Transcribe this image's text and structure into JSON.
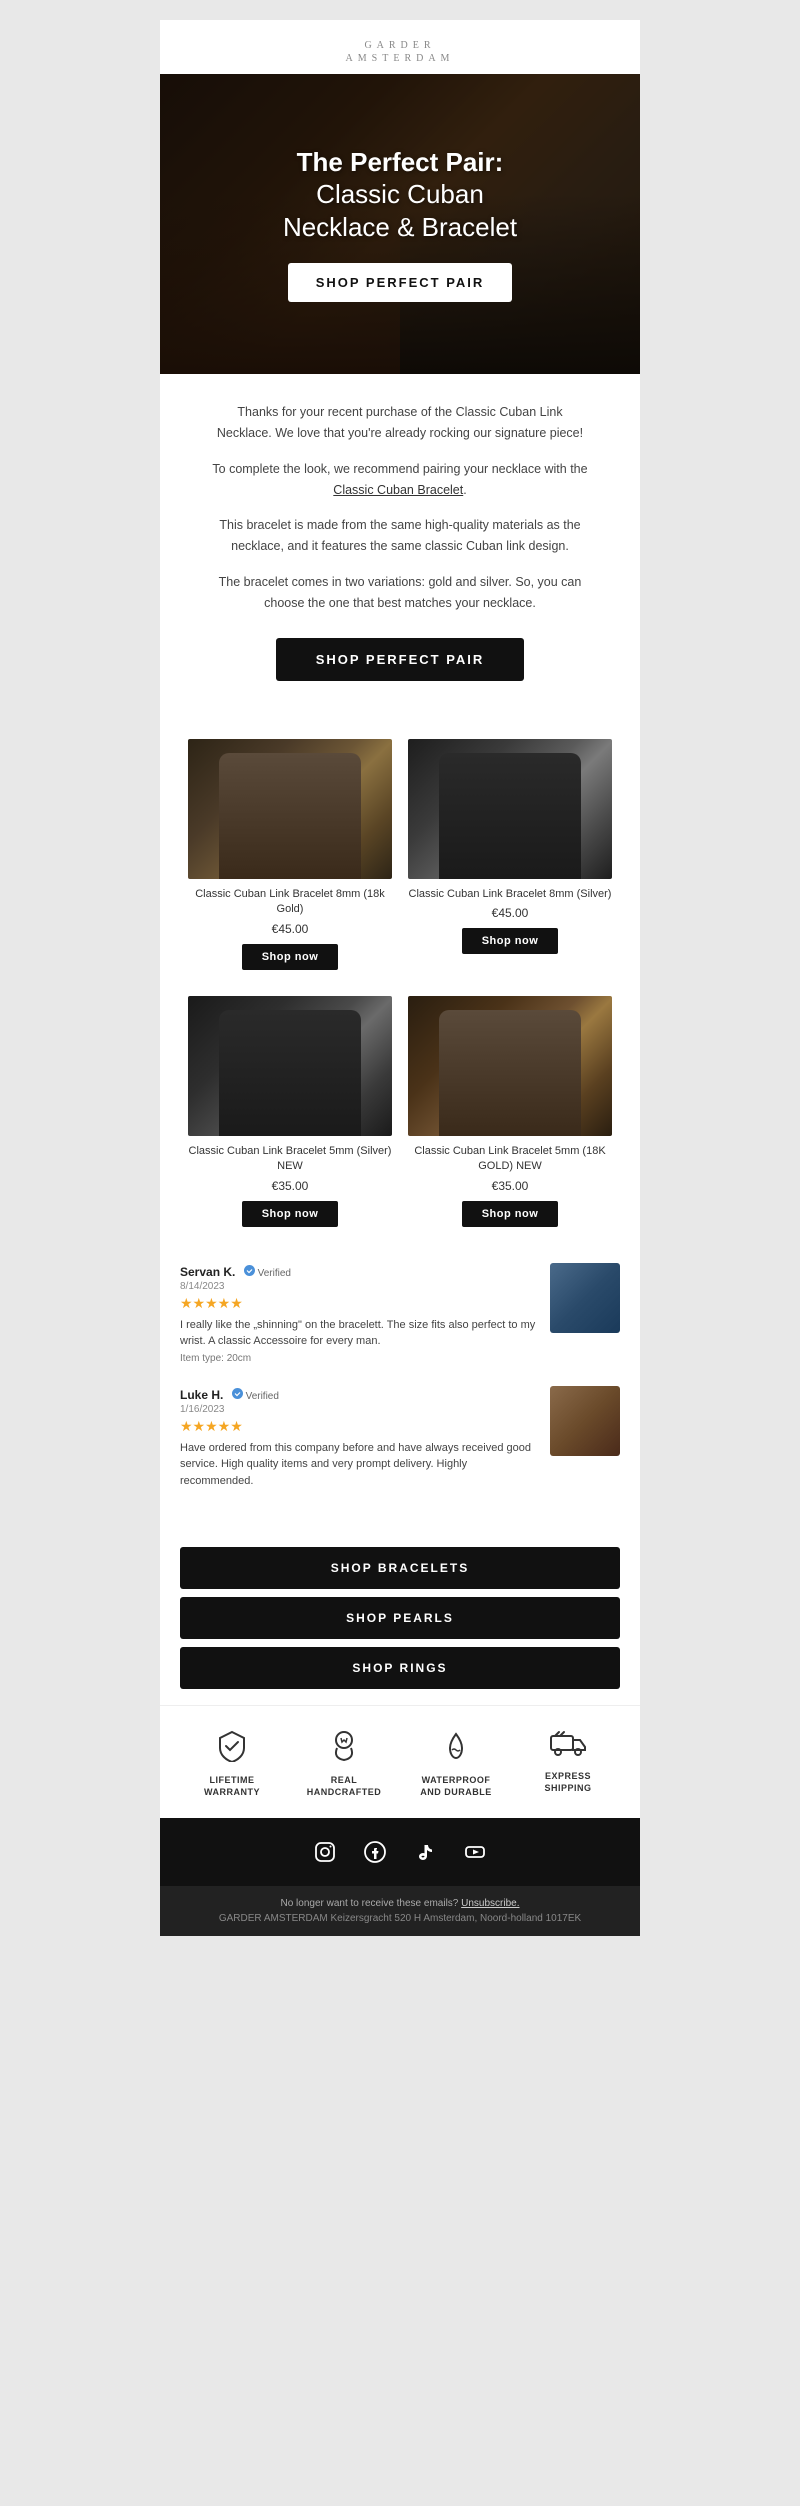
{
  "brand": {
    "name": "GARDER",
    "subtitle": "AMSTERDAM"
  },
  "hero": {
    "title_line1": "The Perfect Pair:",
    "title_line2": "Classic Cuban",
    "title_line3": "Necklace & Bracelet",
    "cta_label": "SHOP PERFECT PAIR"
  },
  "body_text": {
    "para1": "Thanks for your recent purchase of the Classic Cuban Link Necklace. We love that you're already rocking our signature piece!",
    "para2": "To complete the look, we recommend pairing your necklace with the",
    "para2_link": "Classic Cuban Bracelet",
    "para3": "This bracelet is made from the same high-quality materials as the necklace, and it features the same classic Cuban link design.",
    "para4": "The bracelet comes in two variations: gold and silver. So, you can choose the one that best matches your necklace.",
    "shop_btn": "SHOP PERFECT PAIR"
  },
  "products": [
    {
      "id": "p1",
      "name": "Classic Cuban Link Bracelet 8mm (18k Gold)",
      "price": "€45.00",
      "badge": "",
      "img_class": "img-gold-8mm",
      "shop_label": "Shop now"
    },
    {
      "id": "p2",
      "name": "Classic Cuban Link Bracelet 8mm (Silver)",
      "price": "€45.00",
      "badge": "",
      "img_class": "img-silver-8mm",
      "shop_label": "Shop now"
    },
    {
      "id": "p3",
      "name": "Classic Cuban Link Bracelet 5mm (Silver) NEW",
      "price": "€35.00",
      "badge": "",
      "img_class": "img-silver-5mm",
      "shop_label": "Shop now"
    },
    {
      "id": "p4",
      "name": "Classic Cuban Link Bracelet 5mm (18K GOLD) NEW",
      "price": "€35.00",
      "badge": "",
      "img_class": "img-gold-5mm",
      "shop_label": "Shop now"
    }
  ],
  "reviews": [
    {
      "name": "Servan K.",
      "verified": "Verified",
      "date": "8/14/2023",
      "stars": "★★★★★",
      "text": "I really like the „shinning\" on the bracelett. The size fits also perfect to my wrist. A classic Accessoire for every man.",
      "meta_label": "Item type:",
      "meta_value": "20cm",
      "thumb_class": "review-thumb"
    },
    {
      "name": "Luke H.",
      "verified": "Verified",
      "date": "1/16/2023",
      "stars": "★★★★★",
      "text": "Have ordered from this company before and have always received good service. High quality items and very prompt delivery. Highly recommended.",
      "meta_label": "",
      "meta_value": "",
      "thumb_class": "review-thumb review-thumb-2"
    }
  ],
  "categories": [
    {
      "label": "SHOP BRACELETS"
    },
    {
      "label": "SHOP PEARLS"
    },
    {
      "label": "SHOP RINGS"
    }
  ],
  "features": [
    {
      "icon": "✓",
      "label": "LIFETIME\nWARRANTY",
      "icon_name": "warranty-icon"
    },
    {
      "icon": "♛",
      "label": "REAL\nHANDCRAFTED",
      "icon_name": "handcrafted-icon"
    },
    {
      "icon": "◎",
      "label": "WATERPROOF\nAND DURABLE",
      "icon_name": "waterproof-icon"
    },
    {
      "icon": "⚡",
      "label": "EXPRESS\nSHIPPING",
      "icon_name": "shipping-icon"
    }
  ],
  "social": {
    "icons": [
      {
        "name": "instagram",
        "symbol": "📷"
      },
      {
        "name": "facebook",
        "symbol": "f"
      },
      {
        "name": "tiktok",
        "symbol": "♪"
      },
      {
        "name": "youtube",
        "symbol": "▶"
      }
    ]
  },
  "footer": {
    "unsubscribe_text": "No longer want to receive these emails?",
    "unsubscribe_link": "Unsubscribe.",
    "address": "GARDER AMSTERDAM Keizersgracht 520 H Amsterdam, Noord-holland 1017EK"
  }
}
